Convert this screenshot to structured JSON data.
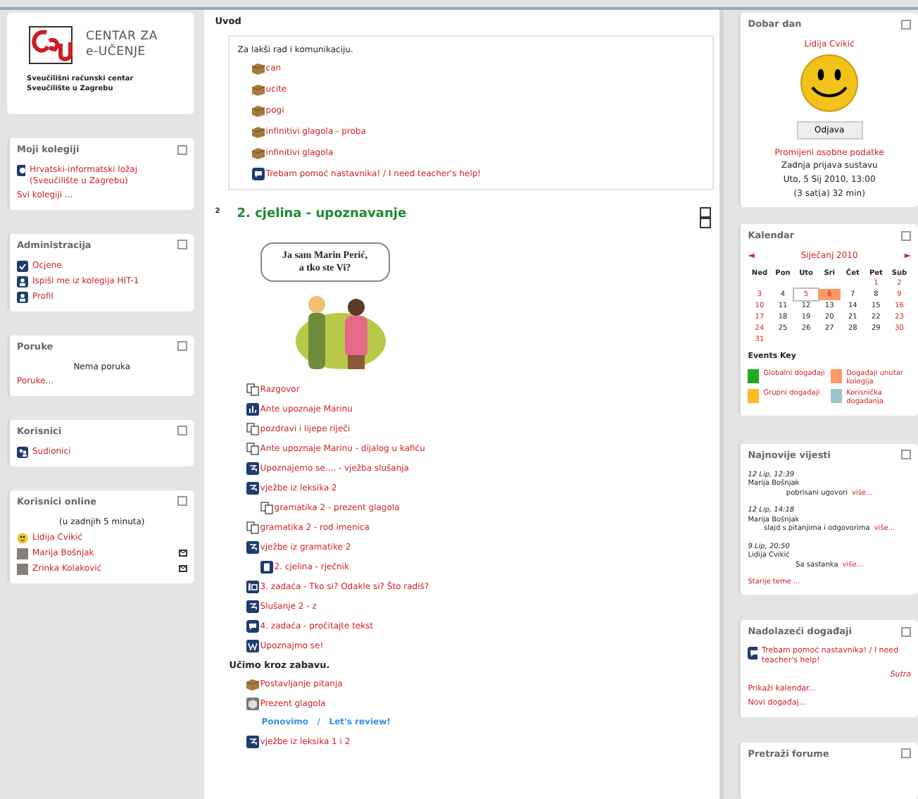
{
  "left": {
    "logo": {
      "line1": "CENTAR ZA",
      "line2": "e-UČENJE",
      "org": [
        "Sveučilišni računski centar",
        "Sveučilište u Zagrebu"
      ]
    },
    "blocks": [
      {
        "title": "Moji kolegiji",
        "items": [
          {
            "kind": "course",
            "text": "Hrvatski-informatski ložaj (Sveučilište u Zagrebu)"
          },
          {
            "kind": "link",
            "text": "Svi kolegiji ..."
          }
        ]
      },
      {
        "title": "Administracija",
        "items": [
          {
            "kind": "grades",
            "text": "Ocjene"
          },
          {
            "kind": "person",
            "text": "Ispiši me iz kolegija HIT-1"
          },
          {
            "kind": "person",
            "text": "Profil"
          }
        ]
      },
      {
        "title": "Poruke",
        "items": [
          {
            "kind": "note",
            "text": "Nema poruka"
          },
          {
            "kind": "link",
            "text": "Poruke..."
          }
        ]
      },
      {
        "title": "Korisnici",
        "items": [
          {
            "kind": "users",
            "text": "Sudionici"
          }
        ]
      },
      {
        "title": "Korisnici online",
        "items": [
          {
            "kind": "note",
            "text": "(u zadnjih 5 minuta)"
          },
          {
            "kind": "smiley",
            "text": "Lidija Cvikić",
            "message": false
          },
          {
            "kind": "photo",
            "text": "Marija Bošnjak",
            "message": true
          },
          {
            "kind": "photo",
            "text": "Zrinka Kolaković",
            "message": true
          }
        ]
      }
    ]
  },
  "intro": {
    "title": "Uvod",
    "text": "Za lakši rad i komunikaciju.",
    "items": [
      {
        "kind": "package",
        "text": "can"
      },
      {
        "kind": "package",
        "text": "ucite"
      },
      {
        "kind": "package",
        "text": "pogi"
      },
      {
        "kind": "package",
        "text": "infinitivi glagola - proba"
      },
      {
        "kind": "package",
        "text": "infinitivi glagola"
      },
      {
        "kind": "forum",
        "text": "Trebam pomoć nastavnika! / I need teacher's help!"
      }
    ]
  },
  "section": {
    "number": "2",
    "title": "2. cjelina - upoznavanje",
    "bubble": [
      "Ja sam Marin Perić,",
      "a tko ste Vi?"
    ],
    "items": [
      {
        "kind": "file",
        "text": "Razgovor"
      },
      {
        "kind": "chart",
        "text": "Ante upoznaje Marinu"
      },
      {
        "kind": "file",
        "text": "pozdravi i lijepe riječi"
      },
      {
        "kind": "file",
        "text": "Ante upoznaje Marinu - dijalog u kafiću"
      },
      {
        "kind": "quiz",
        "text": "Upoznajemo se.... - vježba slušanja"
      },
      {
        "kind": "quiz",
        "text": "vježbe iz leksika 2",
        "children": [
          {
            "kind": "file",
            "text": "gramatika 2 - prezent glagola"
          }
        ]
      },
      {
        "kind": "file",
        "text": "gramatika 2 - rod imenica"
      },
      {
        "kind": "quiz",
        "text": "vježbe iz gramatike 2",
        "children": [
          {
            "kind": "page",
            "text": "2. cjelina - rječnik"
          }
        ]
      },
      {
        "kind": "assignment",
        "text": "3. zadaća - Tko si? Odakle si? Što radiš?"
      },
      {
        "kind": "quiz",
        "text": "Slušanje 2 - z"
      },
      {
        "kind": "forum",
        "text": "4. zadaća - pročitajte tekst"
      },
      {
        "kind": "wiki",
        "text": "Upoznajmo se!"
      },
      {
        "kind": "label",
        "text": "Učimo kroz zabavu."
      },
      {
        "kind": "package",
        "text": "Postavljanje pitanja"
      },
      {
        "kind": "module",
        "text": "Prezent glagola"
      },
      {
        "kind": "review",
        "text": "Ponovimo   /   Let's review!"
      },
      {
        "kind": "quiz",
        "text": "vježbe iz leksika 1 i 2"
      }
    ]
  },
  "greeting": {
    "title": "Dobar dan",
    "name": "Lidija Cvikić",
    "logout": "Odjava",
    "edit": "Promijeni osobne podatke",
    "last_login": [
      "Zadnja prijava sustavu",
      "Uto, 5 Sij 2010, 13:00",
      "(3 sat(a) 32 min)"
    ]
  },
  "calendar": {
    "title": "Kalendar",
    "prev": "◄",
    "month": "Siječanj 2010",
    "next": "►",
    "weekdays": [
      "Ned",
      "Pon",
      "Uto",
      "Sri",
      "Čet",
      "Pet",
      "Sub"
    ],
    "weeks": [
      [
        {
          "kind": "blank"
        },
        {
          "kind": "blank"
        },
        {
          "kind": "blank"
        },
        {
          "kind": "blank"
        },
        {
          "kind": "blank"
        },
        {
          "text": "1",
          "kind": "weekend"
        },
        {
          "text": "2",
          "kind": "weekend"
        }
      ],
      [
        {
          "text": "3",
          "kind": "weekend"
        },
        {
          "text": "4",
          "kind": "normal"
        },
        {
          "text": "5",
          "kind": "today"
        },
        {
          "text": "6",
          "kind": "event"
        },
        {
          "text": "7",
          "kind": "normal"
        },
        {
          "text": "8",
          "kind": "normal"
        },
        {
          "text": "9",
          "kind": "weekend"
        }
      ],
      [
        {
          "text": "10",
          "kind": "weekend"
        },
        {
          "text": "11",
          "kind": "normal"
        },
        {
          "text": "12",
          "kind": "normal"
        },
        {
          "text": "13",
          "kind": "normal"
        },
        {
          "text": "14",
          "kind": "normal"
        },
        {
          "text": "15",
          "kind": "normal"
        },
        {
          "text": "16",
          "kind": "weekend"
        }
      ],
      [
        {
          "text": "17",
          "kind": "weekend"
        },
        {
          "text": "18",
          "kind": "normal"
        },
        {
          "text": "19",
          "kind": "normal"
        },
        {
          "text": "20",
          "kind": "normal"
        },
        {
          "text": "21",
          "kind": "normal"
        },
        {
          "text": "22",
          "kind": "normal"
        },
        {
          "text": "23",
          "kind": "weekend"
        }
      ],
      [
        {
          "text": "24",
          "kind": "weekend"
        },
        {
          "text": "25",
          "kind": "normal"
        },
        {
          "text": "26",
          "kind": "normal"
        },
        {
          "text": "27",
          "kind": "normal"
        },
        {
          "text": "28",
          "kind": "normal"
        },
        {
          "text": "29",
          "kind": "normal"
        },
        {
          "text": "30",
          "kind": "weekend"
        }
      ],
      [
        {
          "text": "31",
          "kind": "weekend"
        }
      ]
    ],
    "key_title": "Events Key",
    "key": [
      {
        "text": "Globalni događaji",
        "color": "#22aa22"
      },
      {
        "text": "Događaji unutar kolegija",
        "color": "#ff9966"
      },
      {
        "text": "Grupni događaji",
        "color": "#ffbb22"
      },
      {
        "text": "Korisnička događanja",
        "color": "#9fc3cc"
      }
    ]
  },
  "news": {
    "title": "Najnovije vijesti",
    "posts": [
      {
        "date": "12 Lip, 12:39",
        "author": "Marija Bošnjak",
        "subject": "pobrisani ugovori",
        "more": "više..."
      },
      {
        "date": "12 Lip, 14:18",
        "author": "Marija Bošnjak",
        "subject": "slajd s pitanjima i odgovorima",
        "more": "više..."
      },
      {
        "date": "9 Lip, 20:50",
        "author": "Lidija Cvikić",
        "subject": "Sa sastanka",
        "more": "više..."
      }
    ],
    "older": "Starije teme ..."
  },
  "events": {
    "title": "Nadolazeći događaji",
    "event": "Trebam pomoć nastavnika! / I need teacher's help!",
    "when": "Sutra",
    "links": [
      "Prikaži kalendar...",
      "Novi događaj..."
    ]
  },
  "search": {
    "title": "Pretraži forume"
  }
}
